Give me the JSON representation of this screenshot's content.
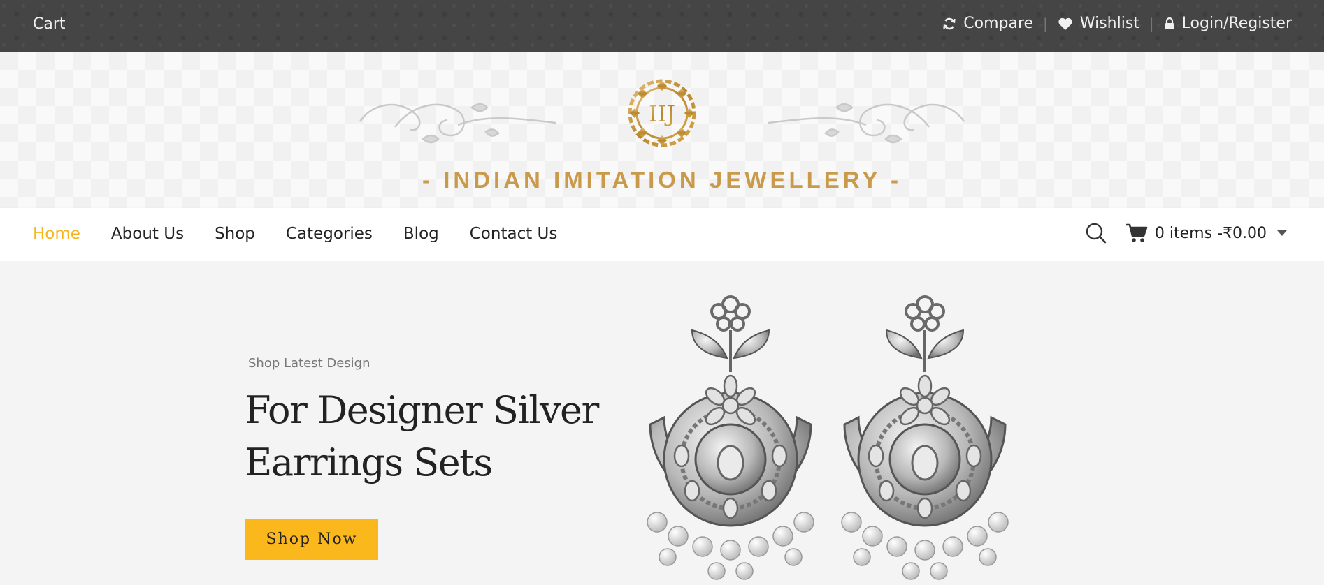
{
  "topbar": {
    "cart_label": "Cart",
    "compare_label": "Compare",
    "wishlist_label": "Wishlist",
    "login_label": "Login/Register",
    "separator": "|"
  },
  "brand": {
    "monogram": "IIJ",
    "name": "- INDIAN IMITATION JEWELLERY -",
    "gold_color": "#c99a4a"
  },
  "nav": {
    "items": [
      {
        "label": "Home",
        "active": true
      },
      {
        "label": "About Us"
      },
      {
        "label": "Shop"
      },
      {
        "label": "Categories"
      },
      {
        "label": "Blog"
      },
      {
        "label": "Contact Us"
      }
    ],
    "cart_summary": "0 items -₹0.00",
    "accent_color": "#f5b51b"
  },
  "hero": {
    "subtitle": "Shop Latest Design",
    "title": "For Designer Silver Earrings Sets",
    "button_label": "Shop Now",
    "button_color": "#fbb81c"
  },
  "icons": [
    "refresh-icon",
    "heart-icon",
    "lock-icon",
    "search-icon",
    "cart-icon",
    "caret-down-icon"
  ]
}
